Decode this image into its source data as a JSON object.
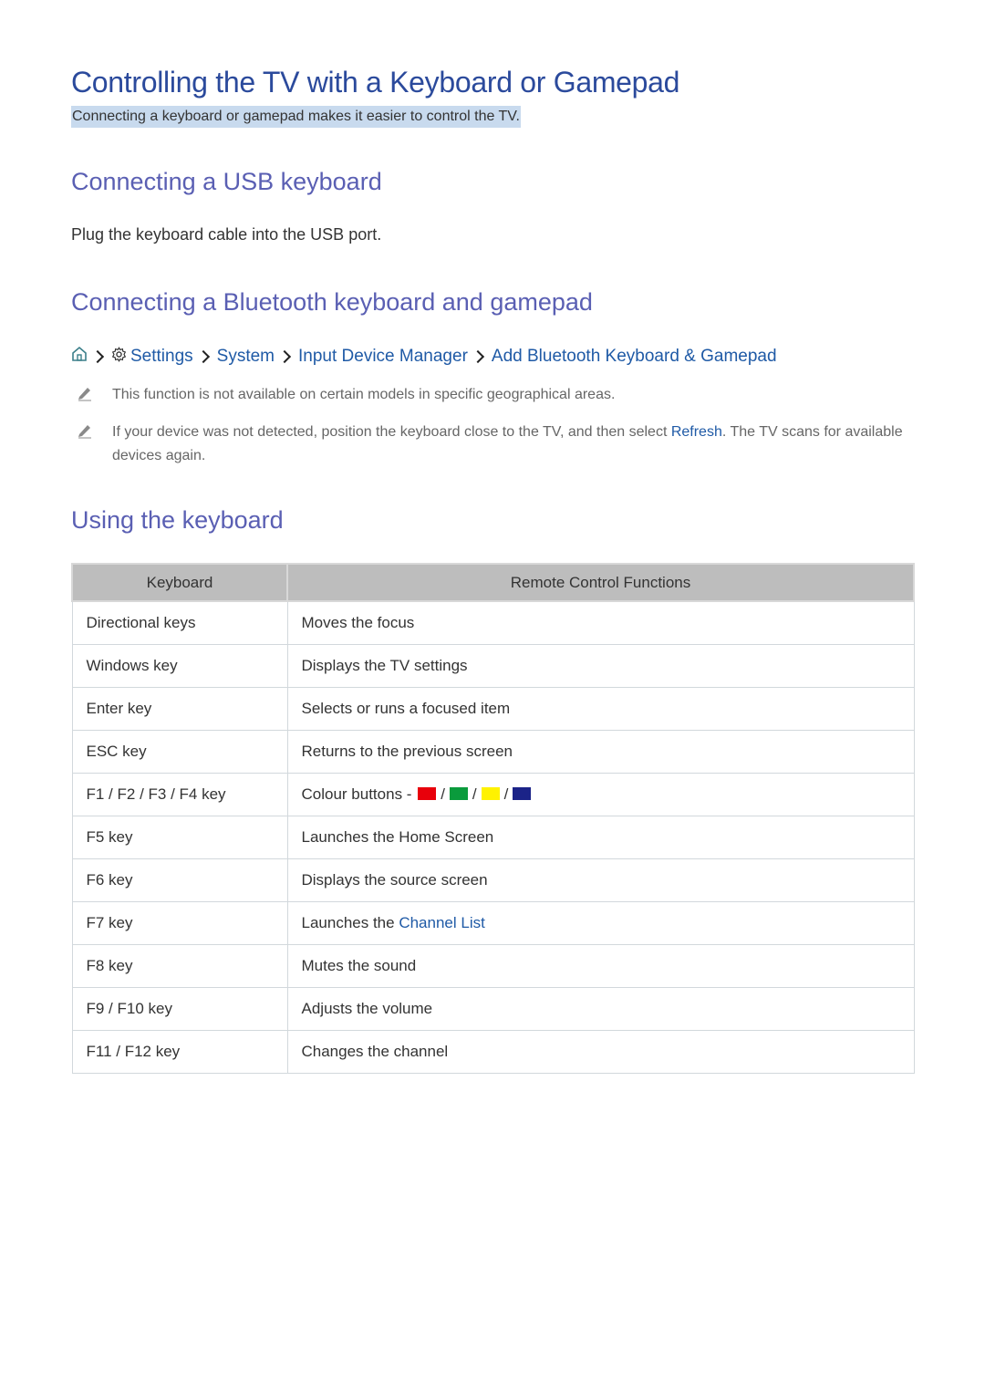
{
  "title": "Controlling the TV with a Keyboard or Gamepad",
  "subtitle": "Connecting a keyboard or gamepad makes it easier to control the TV.",
  "sections": {
    "usb": {
      "heading": "Connecting a USB keyboard",
      "body": "Plug the keyboard cable into the USB port."
    },
    "bluetooth": {
      "heading": "Connecting a Bluetooth keyboard and gamepad",
      "breadcrumb": {
        "home_icon": "home-icon",
        "settings_icon": "gear-icon",
        "items": [
          "Settings",
          "System",
          "Input Device Manager",
          "Add Bluetooth Keyboard & Gamepad"
        ]
      },
      "notes": [
        {
          "icon": "pencil-icon",
          "text": "This function is not available on certain models in specific geographical areas."
        },
        {
          "icon": "pencil-icon",
          "before": "If your device was not detected, position the keyboard close to the TV, and then select ",
          "link": "Refresh",
          "after": ". The TV scans for available devices again."
        }
      ]
    },
    "using": {
      "heading": "Using the keyboard"
    }
  },
  "table": {
    "headers": [
      "Keyboard",
      "Remote Control Functions"
    ],
    "rows": [
      {
        "key": "Directional keys",
        "function": "Moves the focus"
      },
      {
        "key": "Windows key",
        "function": "Displays the TV settings"
      },
      {
        "key": "Enter key",
        "function": "Selects or runs a focused item"
      },
      {
        "key": "ESC key",
        "function": "Returns to the previous screen"
      },
      {
        "key": "F1 / F2 / F3 / F4 key",
        "function": "Colour buttons - ",
        "sep": "/"
      },
      {
        "key": "F5 key",
        "function": "Launches the Home Screen"
      },
      {
        "key": "F6 key",
        "function": "Displays the source screen"
      },
      {
        "key": "F7 key",
        "function": "Launches the ",
        "link": "Channel List"
      },
      {
        "key": "F8 key",
        "function": "Mutes the sound"
      },
      {
        "key": "F9 / F10 key",
        "function": "Adjusts the volume"
      },
      {
        "key": "F11 / F12 key",
        "function": "Changes the channel"
      }
    ],
    "colour_buttons": [
      "#e8000b",
      "#0a9b3c",
      "#fff200",
      "#1b2388"
    ]
  }
}
